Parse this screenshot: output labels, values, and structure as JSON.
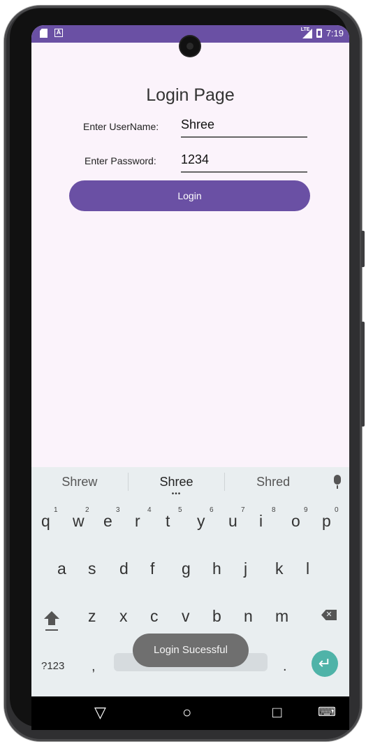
{
  "status": {
    "time": "7:19",
    "network": "LTE",
    "left_icons": [
      "sd-card-icon",
      "a-icon"
    ]
  },
  "app": {
    "title": "Login Page",
    "username_label": "Enter UserName:",
    "username_value": "Shree",
    "password_label": "Enter Password:",
    "password_value": "1234",
    "login_button": "Login"
  },
  "keyboard": {
    "suggestions": [
      "Shrew",
      "Shree",
      "Shred"
    ],
    "row1": [
      "q",
      "w",
      "e",
      "r",
      "t",
      "y",
      "u",
      "i",
      "o",
      "p"
    ],
    "row1_numbers": [
      "1",
      "2",
      "3",
      "4",
      "5",
      "6",
      "7",
      "8",
      "9",
      "0"
    ],
    "row2": [
      "a",
      "s",
      "d",
      "f",
      "g",
      "h",
      "j",
      "k",
      "l"
    ],
    "row3": [
      "z",
      "x",
      "c",
      "v",
      "b",
      "n",
      "m"
    ],
    "bottom": {
      "symbols": "?123",
      "comma": ",",
      "period": "."
    }
  },
  "toast": {
    "text": "Login Sucessful"
  },
  "nav": {
    "back": "▽",
    "home": "○",
    "recents": "□",
    "keyboard_switch": "⌨"
  },
  "colors": {
    "accent": "#6a50a4",
    "background": "#fbf3fb",
    "enter_key": "#4fb3a8",
    "toast": "#6f6f6f"
  }
}
